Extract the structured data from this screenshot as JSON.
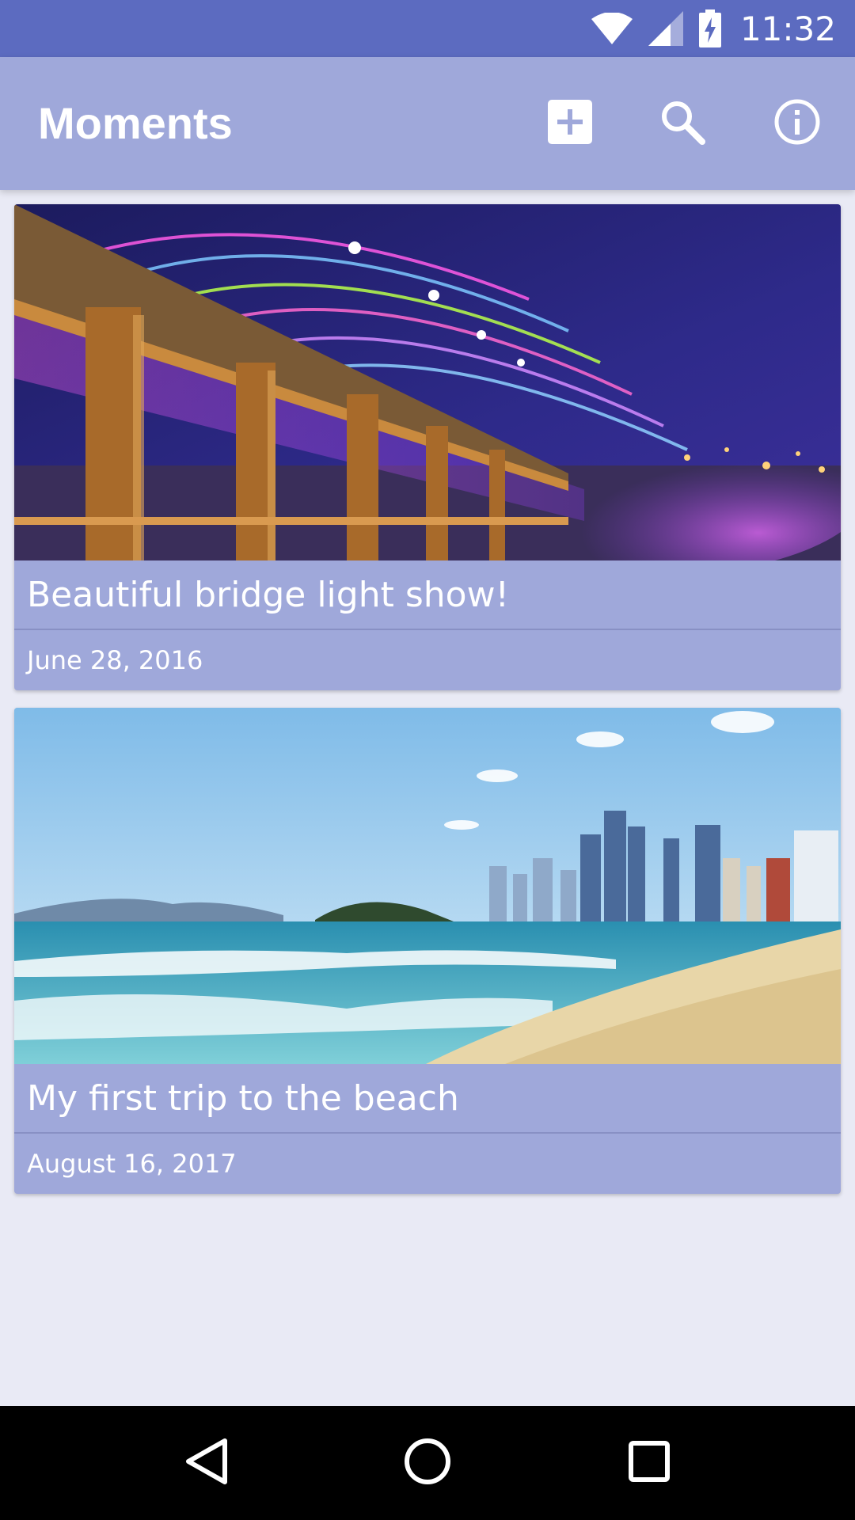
{
  "status_bar": {
    "time": "11:32",
    "icons": [
      "wifi-icon",
      "cell-signal-icon",
      "battery-charging-icon"
    ]
  },
  "app_bar": {
    "title": "Moments",
    "actions": [
      "add-icon",
      "search-icon",
      "info-icon"
    ]
  },
  "moments": [
    {
      "title": "Beautiful bridge light show!",
      "date": "June 28, 2016",
      "image": "bridge-light-show-photo"
    },
    {
      "title": "My first trip to the beach",
      "date": "August 16, 2017",
      "image": "beach-city-photo"
    }
  ],
  "nav_bar": {
    "icons": [
      "back-icon",
      "home-icon",
      "recents-icon"
    ]
  },
  "colors": {
    "status_bar": "#5c6bc0",
    "app_bar": "#9fa8da",
    "background": "#e9eaf5",
    "card": "#9fa8da"
  }
}
